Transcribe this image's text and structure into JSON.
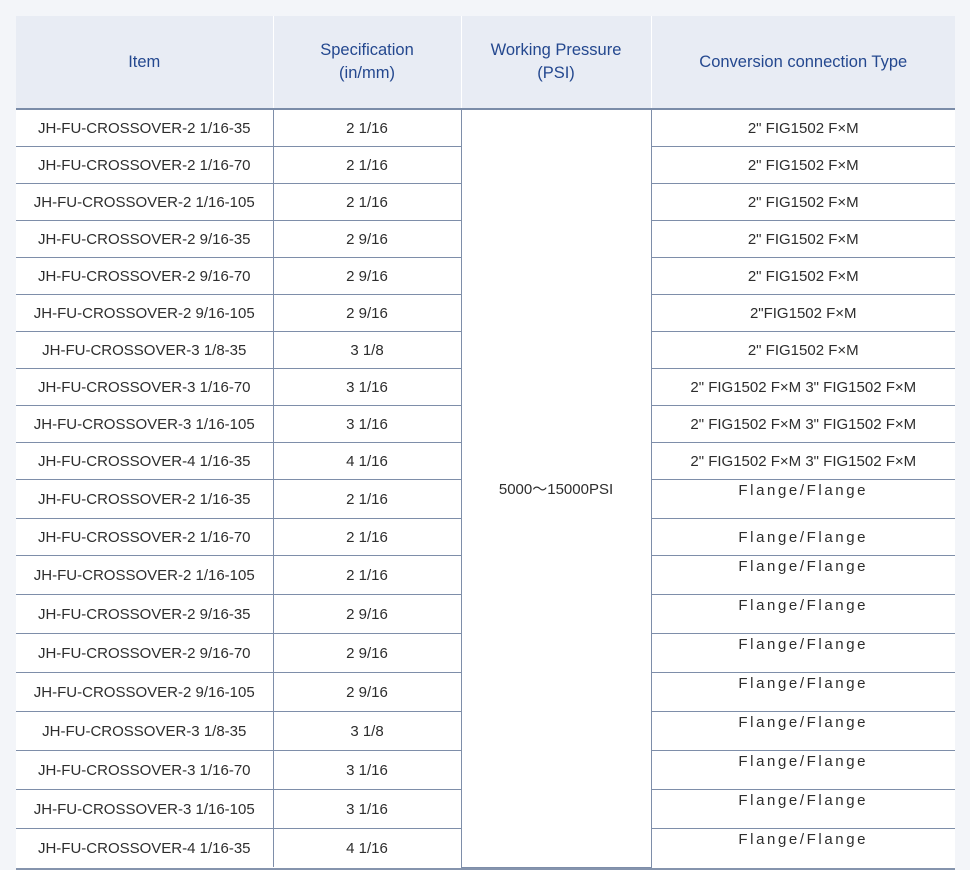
{
  "headers": {
    "item": "Item",
    "specification_line1": "Specification",
    "specification_line2": "(in/mm)",
    "pressure_line1": "Working Pressure",
    "pressure_line2": "(PSI)",
    "conversion": "Conversion connection Type"
  },
  "working_pressure": "5000～15000PSI",
  "rows": [
    {
      "item": "JH-FU-CROSSOVER-2 1/16-35",
      "spec": "2 1/16",
      "conversion": "2\" FIG1502 F×M"
    },
    {
      "item": "JH-FU-CROSSOVER-2 1/16-70",
      "spec": "2 1/16",
      "conversion": "2\" FIG1502 F×M"
    },
    {
      "item": "JH-FU-CROSSOVER-2 1/16-105",
      "spec": "2 1/16",
      "conversion": "2\" FIG1502 F×M"
    },
    {
      "item": "JH-FU-CROSSOVER-2 9/16-35",
      "spec": "2 9/16",
      "conversion": "2\" FIG1502 F×M"
    },
    {
      "item": "JH-FU-CROSSOVER-2 9/16-70",
      "spec": "2 9/16",
      "conversion": "2\" FIG1502 F×M"
    },
    {
      "item": "JH-FU-CROSSOVER-2 9/16-105",
      "spec": "2 9/16",
      "conversion": "2\"FIG1502 F×M"
    },
    {
      "item": "JH-FU-CROSSOVER-3 1/8-35",
      "spec": "3 1/8",
      "conversion": "2\" FIG1502 F×M"
    },
    {
      "item": "JH-FU-CROSSOVER-3 1/16-70",
      "spec": "3 1/16",
      "conversion": "2\" FIG1502 F×M  3\" FIG1502 F×M"
    },
    {
      "item": "JH-FU-CROSSOVER-3 1/16-105",
      "spec": "3 1/16",
      "conversion": "2\" FIG1502 F×M  3\" FIG1502 F×M"
    },
    {
      "item": "JH-FU-CROSSOVER-4 1/16-35",
      "spec": "4 1/16",
      "conversion": "2\" FIG1502 F×M  3\" FIG1502 F×M"
    },
    {
      "item": "JH-FU-CROSSOVER-2 1/16-35",
      "spec": "2 1/16",
      "conversion": "Flange/Flange"
    },
    {
      "item": "JH-FU-CROSSOVER-2 1/16-70",
      "spec": "2 1/16",
      "conversion": "Flange/Flange"
    },
    {
      "item": "JH-FU-CROSSOVER-2 1/16-105",
      "spec": "2 1/16",
      "conversion": "Flange/Flange"
    },
    {
      "item": "JH-FU-CROSSOVER-2 9/16-35",
      "spec": "2 9/16",
      "conversion": "Flange/Flange"
    },
    {
      "item": "JH-FU-CROSSOVER-2 9/16-70",
      "spec": "2 9/16",
      "conversion": "Flange/Flange"
    },
    {
      "item": "JH-FU-CROSSOVER-2 9/16-105",
      "spec": "2 9/16",
      "conversion": "Flange/Flange"
    },
    {
      "item": "JH-FU-CROSSOVER-3 1/8-35",
      "spec": "3 1/8",
      "conversion": "Flange/Flange"
    },
    {
      "item": "JH-FU-CROSSOVER-3 1/16-70",
      "spec": "3 1/16",
      "conversion": "Flange/Flange"
    },
    {
      "item": "JH-FU-CROSSOVER-3 1/16-105",
      "spec": "3 1/16",
      "conversion": "Flange/Flange"
    },
    {
      "item": "JH-FU-CROSSOVER-4 1/16-35",
      "spec": "4 1/16",
      "conversion": "Flange/Flange"
    }
  ],
  "colors": {
    "header_bg": "#e8ecf4",
    "header_text": "#24488f",
    "rule": "#7e8ea9",
    "body_text": "#2d2d2d"
  }
}
